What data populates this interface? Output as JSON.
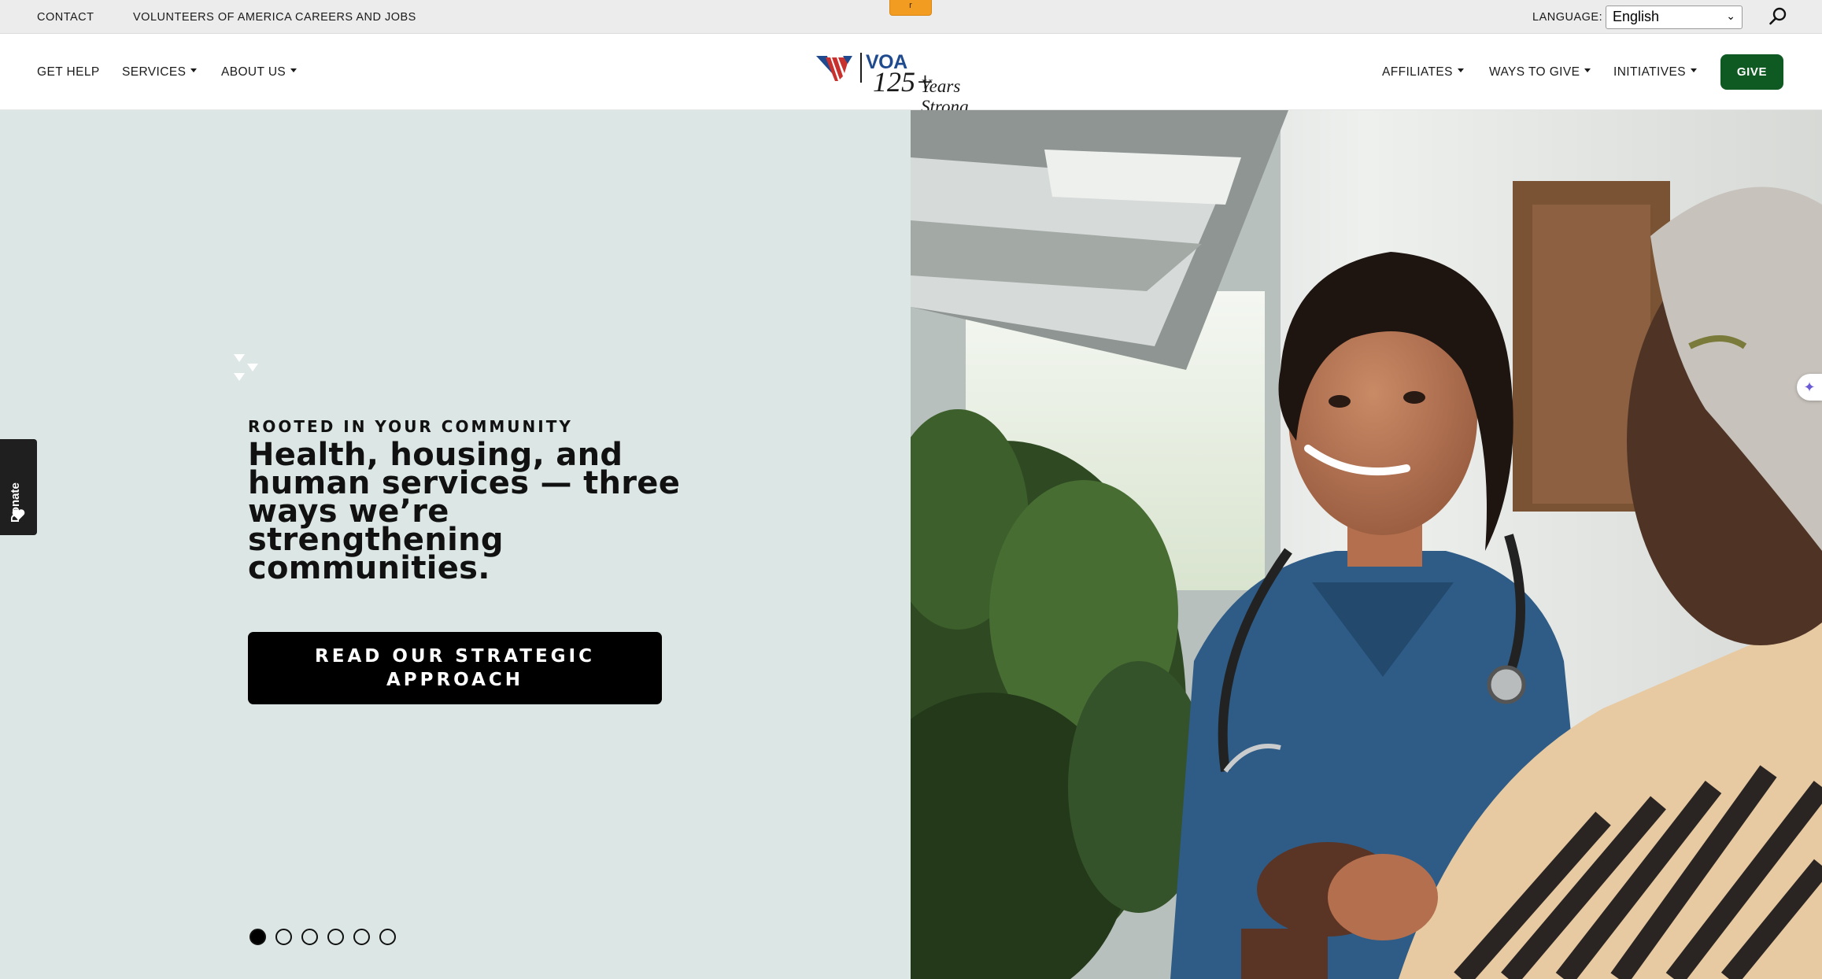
{
  "utility_bar": {
    "contact": "CONTACT",
    "careers": "VOLUNTEERS OF AMERICA CAREERS AND JOBS",
    "tab_glyph": "r",
    "language_label": "LANGUAGE:",
    "language_value": "English"
  },
  "nav": {
    "get_help": "GET HELP",
    "services": "SERVICES",
    "about_us": "ABOUT US",
    "affiliates": "AFFILIATES",
    "ways_to_give": "WAYS TO GIVE",
    "initiatives": "INITIATIVES",
    "give": "GIVE"
  },
  "logo": {
    "voa": "VOA",
    "years": "125+",
    "tagline": "Years Strong"
  },
  "hero": {
    "eyebrow": "ROOTED IN YOUR COMMUNITY",
    "heading": "Health, housing, and human services — three ways we’re strengthening communities.",
    "cta": "READ OUR STRATEGIC APPROACH",
    "slide_count": 6,
    "active_slide": 1
  },
  "side": {
    "donate": "Donate"
  },
  "colors": {
    "hero_bg": "#dce7e5",
    "give_green": "#0f5a22",
    "accessibility_blue": "#1d4f98",
    "brand_blue": "#1f4b8e",
    "brand_red": "#c8312e"
  },
  "icons": [
    "search-icon",
    "accessibility-icon",
    "ai-sparkle-icon",
    "heart-icon",
    "flag-logo-icon",
    "chevron-down-icon"
  ]
}
